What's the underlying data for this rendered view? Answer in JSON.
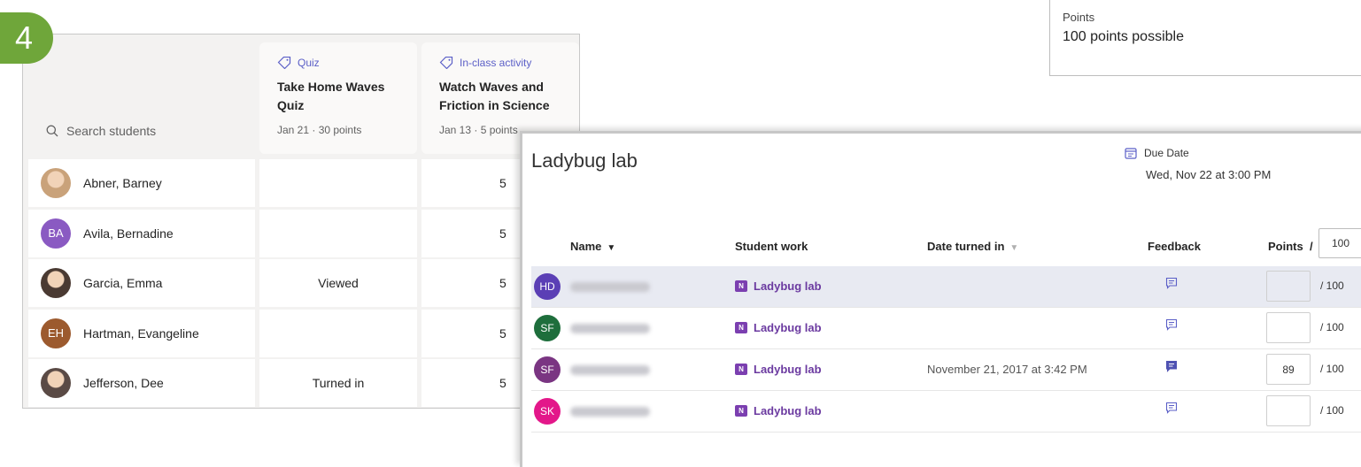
{
  "badge": "4",
  "points_card": {
    "label": "Points",
    "value": "100 points possible"
  },
  "gradebook": {
    "search_placeholder": "Search students",
    "columns": [
      {
        "type": "Quiz",
        "title": "Take Home Waves Quiz",
        "meta": "Jan 21 · 30 points"
      },
      {
        "type": "In-class activity",
        "title": "Watch Waves and Friction in Science",
        "meta": "Jan 13 · 5 points"
      }
    ],
    "rows": [
      {
        "name": "Abner, Barney",
        "initials": "",
        "avatar_color": "#c9a27a",
        "photo": true,
        "c1": "",
        "c2": "5"
      },
      {
        "name": "Avila, Bernadine",
        "initials": "BA",
        "avatar_color": "#8a5ac2",
        "photo": false,
        "c1": "",
        "c2": "5"
      },
      {
        "name": "Garcia, Emma",
        "initials": "",
        "avatar_color": "#4a3a32",
        "photo": true,
        "c1": "Viewed",
        "c2": "5"
      },
      {
        "name": "Hartman, Evangeline",
        "initials": "EH",
        "avatar_color": "#9c5a2e",
        "photo": false,
        "c1": "",
        "c2": "5"
      },
      {
        "name": "Jefferson, Dee",
        "initials": "",
        "avatar_color": "#5a4a45",
        "photo": true,
        "c1": "Turned in",
        "c2": "5"
      }
    ]
  },
  "ladybug": {
    "title": "Ladybug lab",
    "due_label": "Due Date",
    "due_date": "Wed, Nov 22 at 3:00 PM",
    "headers": {
      "name": "Name",
      "student_work": "Student work",
      "date_turned_in": "Date turned in",
      "feedback": "Feedback",
      "points": "Points  /"
    },
    "points_total": "100",
    "rows": [
      {
        "initials": "HD",
        "avatar_color": "#5b3fb5",
        "work": "Ladybug lab",
        "date": "",
        "feedback_filled": false,
        "points": "",
        "out_of": "/ 100",
        "selected": true
      },
      {
        "initials": "SF",
        "avatar_color": "#1e6e3c",
        "work": "Ladybug lab",
        "date": "",
        "feedback_filled": false,
        "points": "",
        "out_of": "/ 100",
        "selected": false
      },
      {
        "initials": "SF",
        "avatar_color": "#7a3582",
        "work": "Ladybug lab",
        "date": "November 21, 2017 at 3:42 PM",
        "feedback_filled": true,
        "points": "89",
        "out_of": "/ 100",
        "selected": false
      },
      {
        "initials": "SK",
        "avatar_color": "#e3178a",
        "work": "Ladybug lab",
        "date": "",
        "feedback_filled": false,
        "points": "",
        "out_of": "/ 100",
        "selected": false
      }
    ]
  },
  "colors": {
    "accent": "#5b5fc7",
    "badge": "#6fa63a",
    "onenote": "#7b3fb0"
  }
}
